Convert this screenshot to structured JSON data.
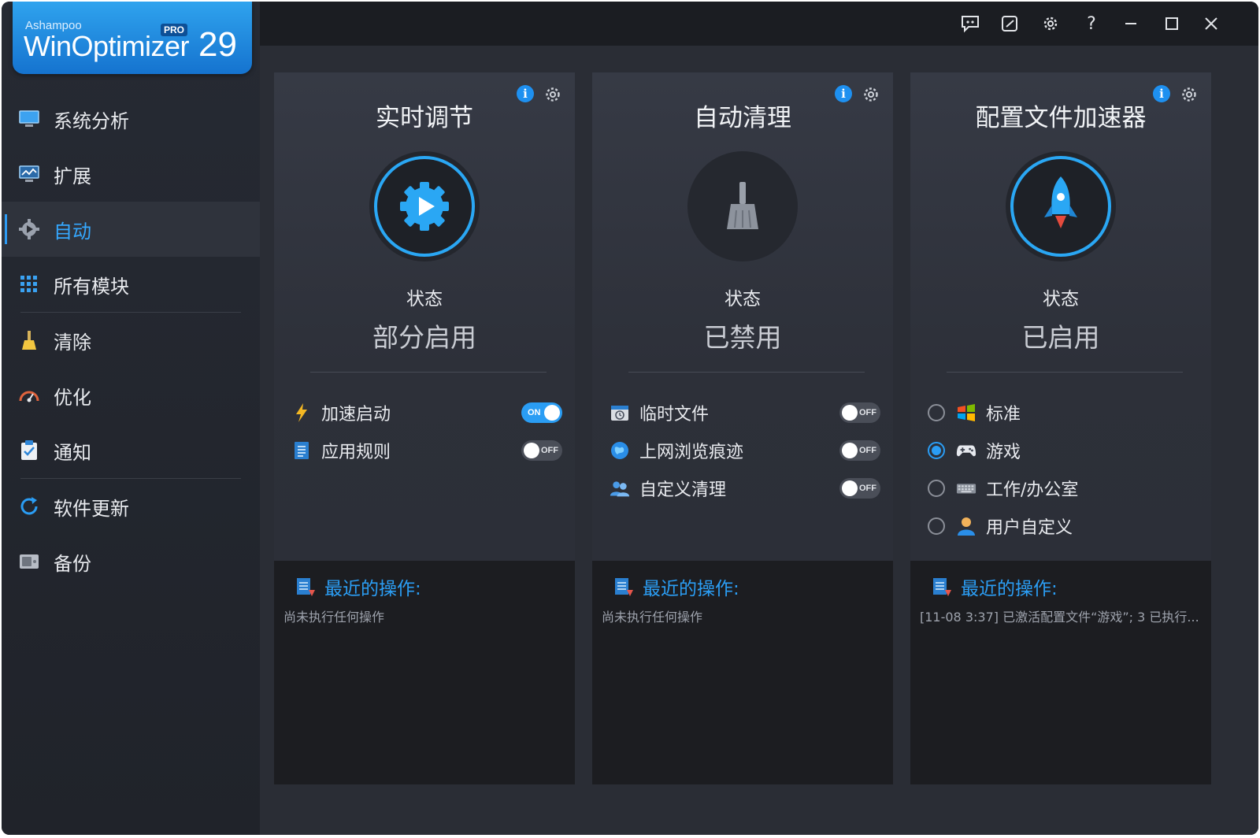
{
  "app": {
    "brand": "Ashampoo",
    "product": "WinOptimizer",
    "edition": "PRO",
    "version": "29"
  },
  "sidebar": {
    "items": [
      {
        "label": "系统分析",
        "icon": "monitor-icon"
      },
      {
        "label": "扩展",
        "icon": "chart-monitor-icon"
      },
      {
        "label": "自动",
        "icon": "gear-play-icon",
        "active": true
      },
      {
        "label": "所有模块",
        "icon": "grid-icon"
      },
      {
        "label": "清除",
        "icon": "broom-icon"
      },
      {
        "label": "优化",
        "icon": "gauge-icon"
      },
      {
        "label": "通知",
        "icon": "clipboard-check-icon"
      },
      {
        "label": "软件更新",
        "icon": "refresh-icon"
      },
      {
        "label": "备份",
        "icon": "drive-icon"
      }
    ]
  },
  "titlebar": {
    "icons": [
      "feedback-icon",
      "edit-icon",
      "settings-icon",
      "help-icon",
      "minimize-icon",
      "maximize-icon",
      "close-icon"
    ],
    "help_glyph": "?"
  },
  "cards": [
    {
      "title": "实时调节",
      "status_label": "状态",
      "status_value": "部分启用",
      "options": [
        {
          "label": "加速启动",
          "toggle": "ON"
        },
        {
          "label": "应用规则",
          "toggle": "OFF"
        }
      ],
      "recent_title": "最近的操作:",
      "recent_text": "尚未执行任何操作"
    },
    {
      "title": "自动清理",
      "status_label": "状态",
      "status_value": "已禁用",
      "options": [
        {
          "label": "临时文件",
          "toggle": "OFF"
        },
        {
          "label": "上网浏览痕迹",
          "toggle": "OFF"
        },
        {
          "label": "自定义清理",
          "toggle": "OFF"
        }
      ],
      "recent_title": "最近的操作:",
      "recent_text": "尚未执行任何操作"
    },
    {
      "title": "配置文件加速器",
      "status_label": "状态",
      "status_value": "已启用",
      "options": [
        {
          "label": "标准",
          "selected": false
        },
        {
          "label": "游戏",
          "selected": true
        },
        {
          "label": "工作/办公室",
          "selected": false
        },
        {
          "label": "用户自定义",
          "selected": false
        }
      ],
      "recent_title": "最近的操作:",
      "recent_text": "[11-08 3:37] 已激活配置文件“游戏”; 3 已执行..."
    }
  ],
  "colors": {
    "accent": "#2a9df4",
    "sidebar_active_text": "#35a8ff",
    "toggle_on": "#2a9df4",
    "toggle_off": "#4a4e58"
  }
}
